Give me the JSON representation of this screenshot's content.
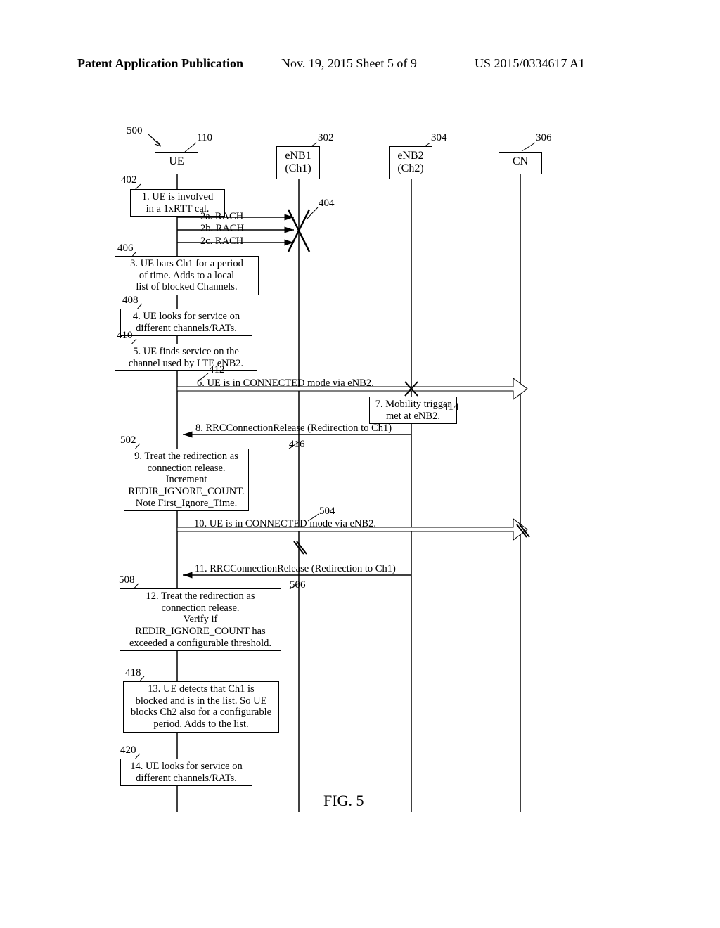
{
  "header": {
    "left": "Patent Application Publication",
    "center": "Nov. 19, 2015  Sheet 5 of 9",
    "right": "US 2015/0334617 A1"
  },
  "refs": {
    "r500": "500",
    "r110": "110",
    "r302": "302",
    "r304": "304",
    "r306": "306",
    "r402": "402",
    "r404": "404",
    "r406": "406",
    "r408": "408",
    "r410": "410",
    "r412": "412",
    "r414": "414",
    "r416": "416",
    "r502": "502",
    "r504": "504",
    "r506": "506",
    "r508": "508",
    "r418": "418",
    "r420": "420"
  },
  "actors": {
    "ue": "UE",
    "enb1_line1": "eNB1",
    "enb1_line2": "(Ch1)",
    "enb2_line1": "eNB2",
    "enb2_line2": "(Ch2)",
    "cn": "CN"
  },
  "notes": {
    "n1": "1. UE is involved\nin a 1xRTT cal.",
    "n3": "3. UE bars Ch1 for a period\nof time. Adds to a local\nlist of blocked Channels.",
    "n4": "4. UE looks for service on\ndifferent channels/RATs.",
    "n5": "5. UE finds service on the\nchannel used by LTE eNB2.",
    "n7": "7. Mobility trigger\nmet at eNB2.",
    "n9": "9. Treat the redirection as\nconnection release.\nIncrement\nREDIR_IGNORE_COUNT.\nNote First_Ignore_Time.",
    "n12": "12. Treat the redirection as\nconnection release.\nVerify if\nREDIR_IGNORE_COUNT has\nexceeded a configurable threshold.",
    "n13": "13. UE detects that Ch1 is\nblocked and is in the list. So UE\nblocks Ch2 also for a configurable\nperiod. Adds to the list.",
    "n14": "14. UE looks for service on\ndifferent channels/RATs."
  },
  "msgs": {
    "m2a": "2a. RACH",
    "m2b": "2b. RACH",
    "m2c": "2c. RACH",
    "m6": "6. UE is in CONNECTED mode via eNB2.",
    "m8": "8. RRCConnectionRelease (Redirection to Ch1)",
    "m10": "10. UE is in CONNECTED mode via eNB2.",
    "m11": "11. RRCConnectionRelease (Redirection to Ch1)"
  },
  "fig": "FIG. 5"
}
